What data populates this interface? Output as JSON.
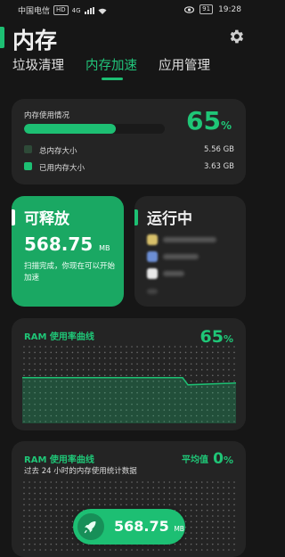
{
  "status_bar": {
    "carrier": "中国电信",
    "network_badge": "HD",
    "network": "4G",
    "battery": "91",
    "time": "19:28"
  },
  "header": {
    "title": "内存",
    "settings_icon": "gear-icon"
  },
  "tabs": [
    {
      "label": "垃圾清理",
      "active": false
    },
    {
      "label": "内存加速",
      "active": true
    },
    {
      "label": "应用管理",
      "active": false
    }
  ],
  "memory": {
    "label": "内存使用情况",
    "percent": 65,
    "percent_unit": "%",
    "legend": [
      {
        "label": "总内存大小",
        "value": "5.56 GB",
        "color": "#2e4a38"
      },
      {
        "label": "已用内存大小",
        "value": "3.63 GB",
        "color": "#1dbf73"
      }
    ]
  },
  "release": {
    "title": "可释放",
    "value": "568.75",
    "unit": "MB",
    "desc": "扫描完成，你现在可以开始加速"
  },
  "running": {
    "title": "运行中"
  },
  "ram_curve": {
    "title": "RAM 使用率曲线",
    "percent": "65",
    "unit": "%"
  },
  "ram_curve2": {
    "title": "RAM 使用率曲线",
    "subtitle": "过去 24 小时的内存使用统计数据",
    "avg_label": "平均值",
    "avg_value": "0",
    "avg_unit": "%"
  },
  "boost": {
    "value": "568.75",
    "unit": "MB",
    "icon": "rocket-icon"
  },
  "colors": {
    "accent": "#1dbf73",
    "background": "#161616",
    "card": "#242424"
  }
}
